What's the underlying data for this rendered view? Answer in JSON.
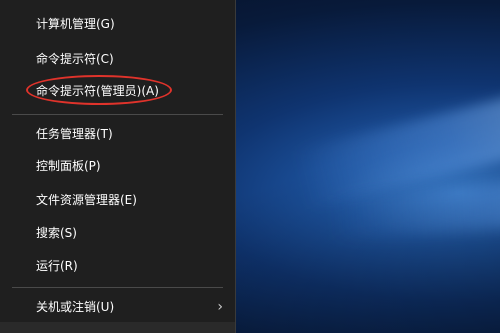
{
  "menu": {
    "items": [
      {
        "label": "计算机管理(G)"
      },
      {
        "label": "命令提示符(C)"
      },
      {
        "label": "命令提示符(管理员)(A)"
      },
      {
        "label": "任务管理器(T)"
      },
      {
        "label": "控制面板(P)"
      },
      {
        "label": "文件资源管理器(E)"
      },
      {
        "label": "搜索(S)"
      },
      {
        "label": "运行(R)"
      },
      {
        "label": "关机或注销(U)"
      }
    ],
    "submenu_indicator": "›"
  },
  "colors": {
    "menu_background": "#1f1f1f",
    "menu_text": "#ffffff",
    "highlight_ring": "#e0332b"
  }
}
